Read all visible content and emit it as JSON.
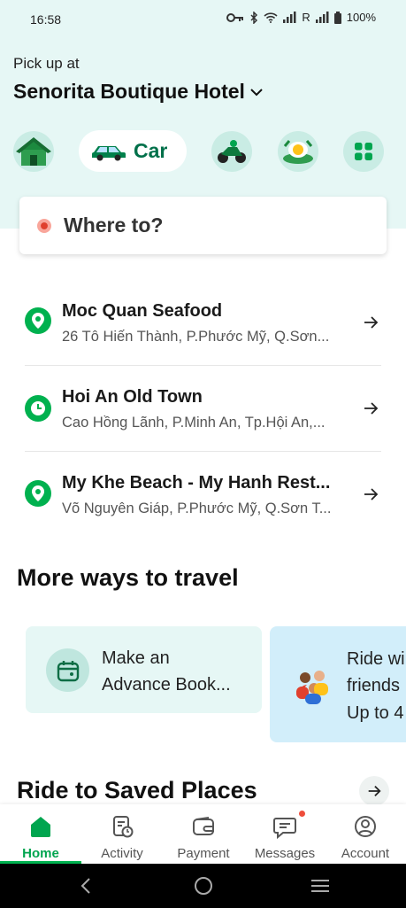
{
  "status_bar": {
    "time": "16:58",
    "carrier": "R",
    "battery": "100%"
  },
  "pickup": {
    "label": "Pick up at",
    "place": "Senorita Boutique Hotel"
  },
  "services": {
    "items": [
      {
        "name": "home",
        "icon": "house-icon"
      },
      {
        "name": "car",
        "label": "Car",
        "icon": "car-icon",
        "selected": true
      },
      {
        "name": "bike",
        "icon": "motorbike-icon"
      },
      {
        "name": "food",
        "icon": "food-icon"
      },
      {
        "name": "more",
        "icon": "grid-icon"
      }
    ]
  },
  "search": {
    "placeholder": "Where to?"
  },
  "recent_destinations": [
    {
      "title": "Moc Quan Seafood",
      "address": "26 Tô Hiến Thành, P.Phước Mỹ, Q.Sơn...",
      "icon": "pin-icon"
    },
    {
      "title": "Hoi An Old Town",
      "address": "Cao Hồng Lãnh, P.Minh An, Tp.Hội An,...",
      "icon": "clock-icon"
    },
    {
      "title": "My Khe Beach - My Hanh Rest...",
      "address": "Võ Nguyên Giáp, P.Phước Mỹ, Q.Sơn T...",
      "icon": "pin-icon"
    }
  ],
  "more_ways": {
    "title": "More ways to travel",
    "cards": [
      {
        "line1": "Make an",
        "line2": "Advance Book...",
        "icon": "calendar-icon"
      },
      {
        "line1": "Ride wi",
        "line2": "friends",
        "line3": "Up to 4",
        "icon": "group-icon"
      }
    ]
  },
  "saved_places": {
    "title": "Ride to Saved Places"
  },
  "bottom_nav": {
    "items": [
      {
        "label": "Home",
        "icon": "home-icon",
        "active": true
      },
      {
        "label": "Activity",
        "icon": "activity-icon"
      },
      {
        "label": "Payment",
        "icon": "wallet-icon"
      },
      {
        "label": "Messages",
        "icon": "chat-icon",
        "badge": true
      },
      {
        "label": "Account",
        "icon": "account-icon"
      }
    ]
  },
  "colors": {
    "brand": "#00b14f",
    "header_bg": "#e6f7f5",
    "accent_red": "#e0402e"
  }
}
